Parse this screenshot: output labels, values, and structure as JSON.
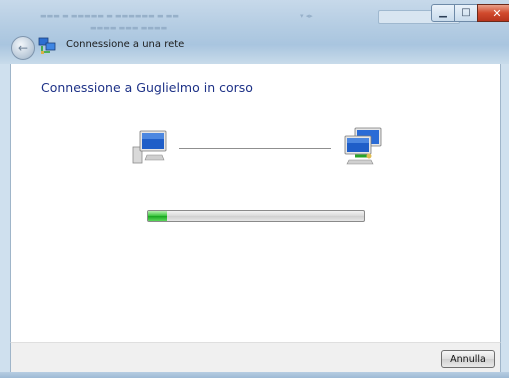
{
  "window": {
    "title": "Connessione a una rete",
    "controls": {
      "minimize_icon": "minimize-icon",
      "maximize_icon": "maximize-icon",
      "close_icon": "close-icon"
    }
  },
  "content": {
    "heading": "Connessione a Guglielmo in corso",
    "progress": 0.09
  },
  "footer": {
    "cancel_label": "Annulla"
  },
  "colors": {
    "heading": "#1e3287",
    "progress_fill": "#2fbf35",
    "close_button": "#c7422a"
  }
}
